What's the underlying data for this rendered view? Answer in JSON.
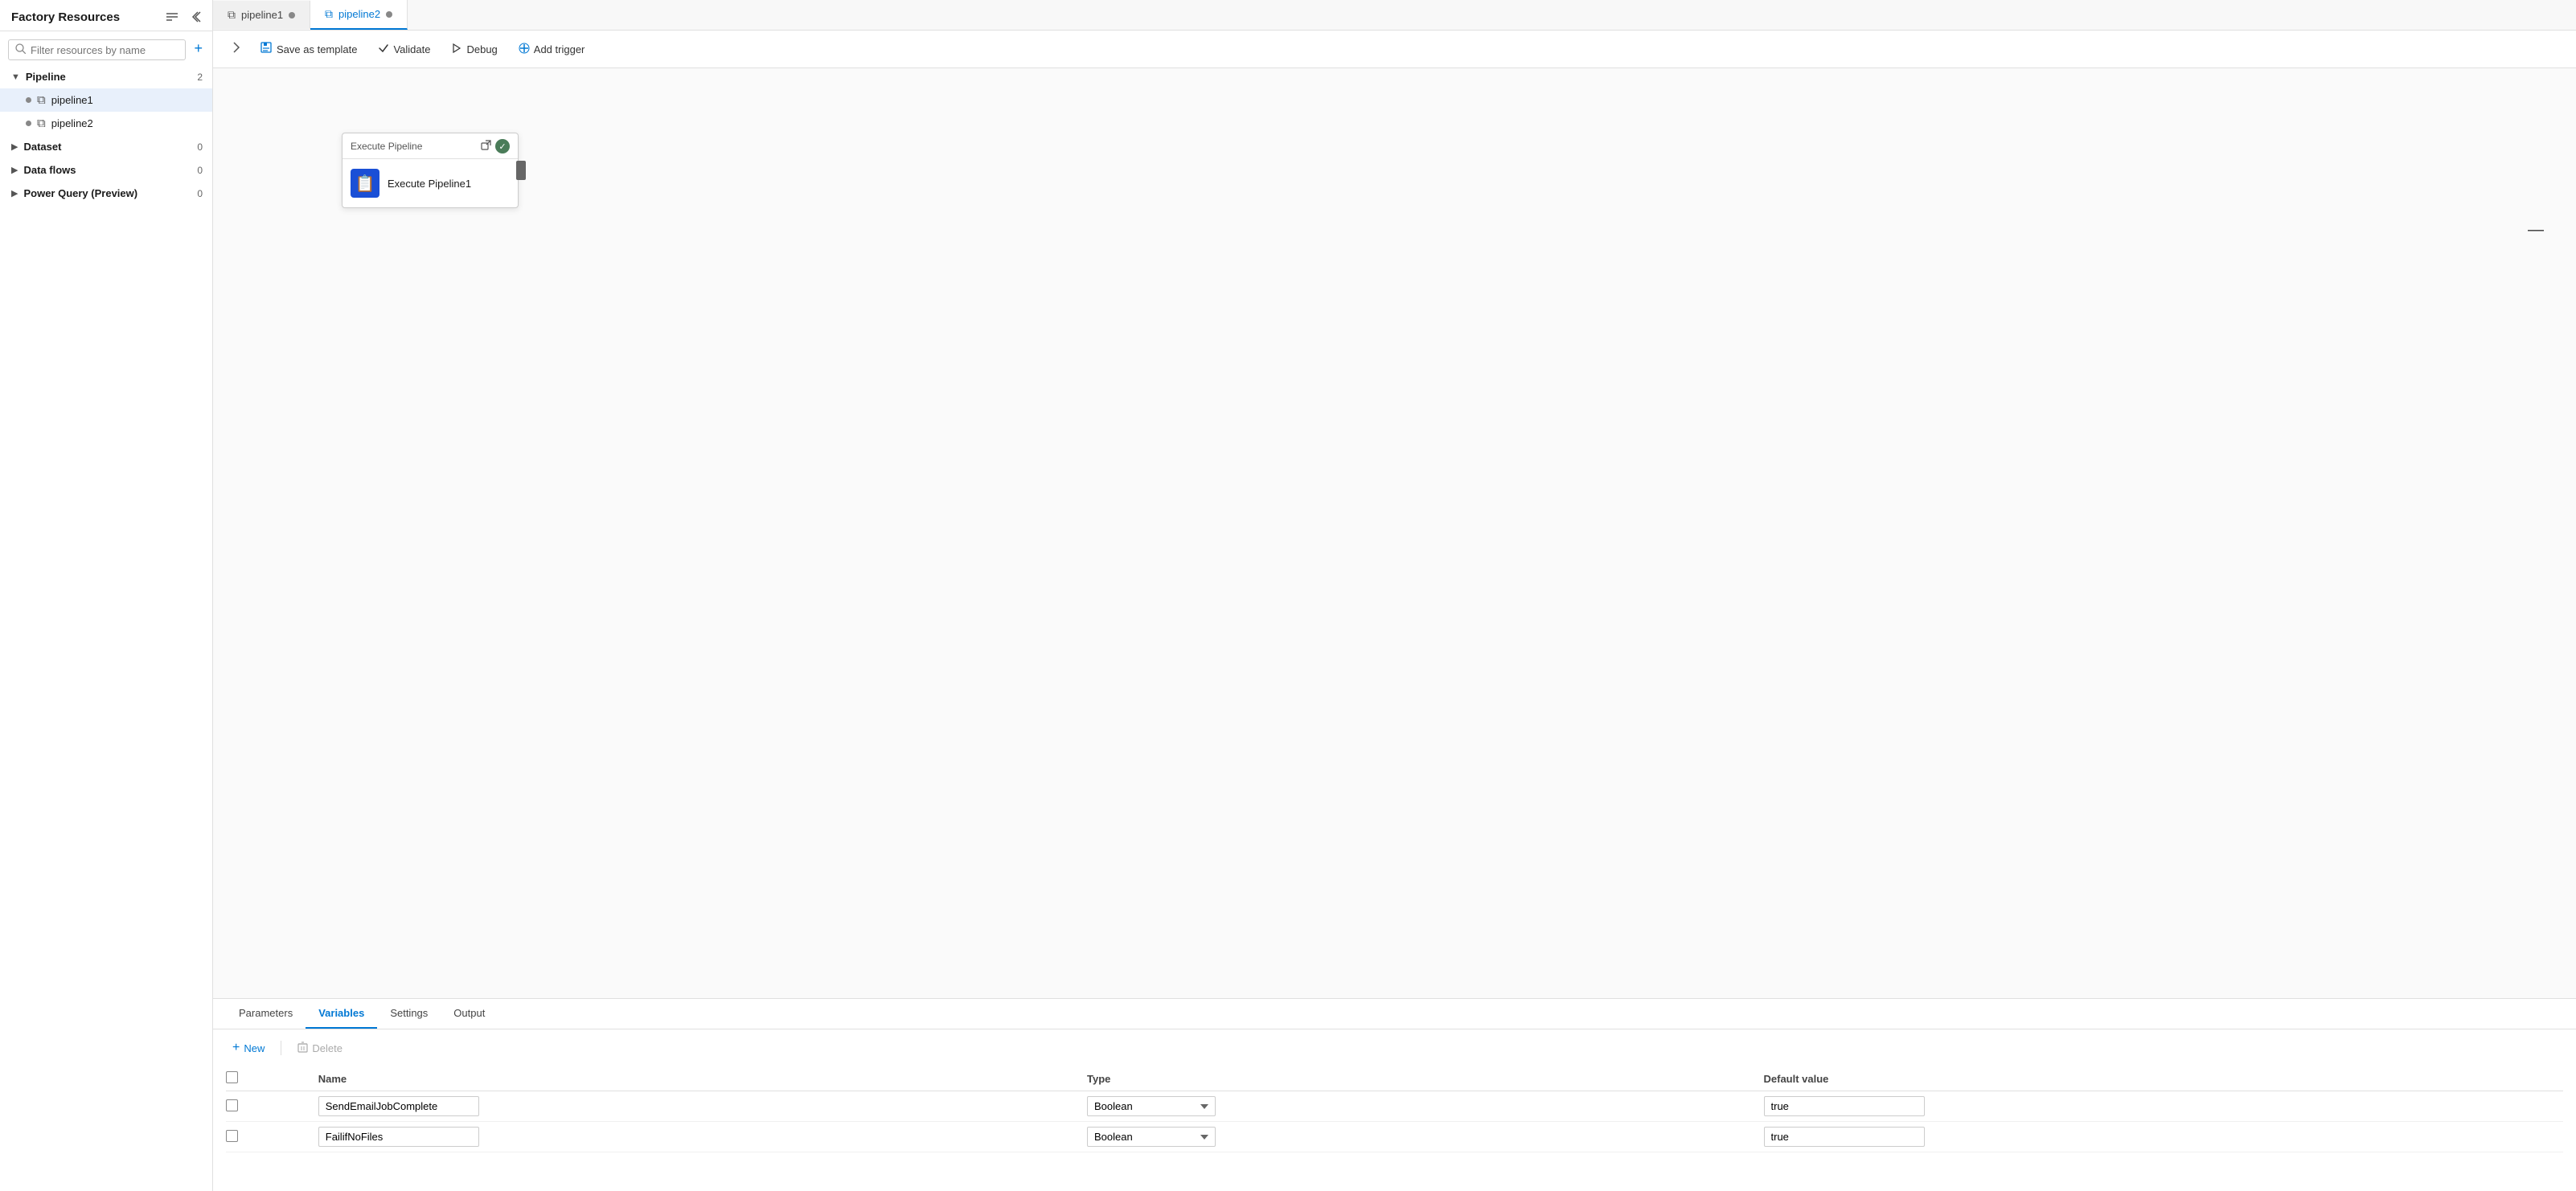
{
  "sidebar": {
    "title": "Factory Resources",
    "search_placeholder": "Filter resources by name",
    "add_icon": "+",
    "collapse_icon": "⌄⌄",
    "shrink_icon": "«",
    "sections": [
      {
        "label": "Pipeline",
        "count": "2",
        "expanded": true,
        "items": [
          {
            "label": "pipeline1",
            "active": true
          },
          {
            "label": "pipeline2",
            "active": false
          }
        ]
      },
      {
        "label": "Dataset",
        "count": "0",
        "expanded": false,
        "items": []
      },
      {
        "label": "Data flows",
        "count": "0",
        "expanded": false,
        "items": []
      },
      {
        "label": "Power Query (Preview)",
        "count": "0",
        "expanded": false,
        "items": []
      }
    ]
  },
  "tabs": [
    {
      "label": "pipeline1",
      "active": false
    },
    {
      "label": "pipeline2",
      "active": true
    }
  ],
  "toolbar": {
    "expand_icon": "»",
    "save_template_label": "Save as template",
    "validate_label": "Validate",
    "debug_label": "Debug",
    "add_trigger_label": "Add trigger"
  },
  "canvas": {
    "card": {
      "header_title": "Execute Pipeline",
      "body_label": "Execute Pipeline1"
    }
  },
  "bottom_panel": {
    "tabs": [
      {
        "label": "Parameters",
        "active": false
      },
      {
        "label": "Variables",
        "active": true
      },
      {
        "label": "Settings",
        "active": false
      },
      {
        "label": "Output",
        "active": false
      }
    ],
    "new_label": "New",
    "delete_label": "Delete",
    "table_headers": [
      "Name",
      "Type",
      "Default value"
    ],
    "rows": [
      {
        "name": "SendEmailJobComplete",
        "type": "Boolean",
        "default_value": "true"
      },
      {
        "name": "FailifNoFiles",
        "type": "Boolean",
        "default_value": "true"
      }
    ]
  }
}
